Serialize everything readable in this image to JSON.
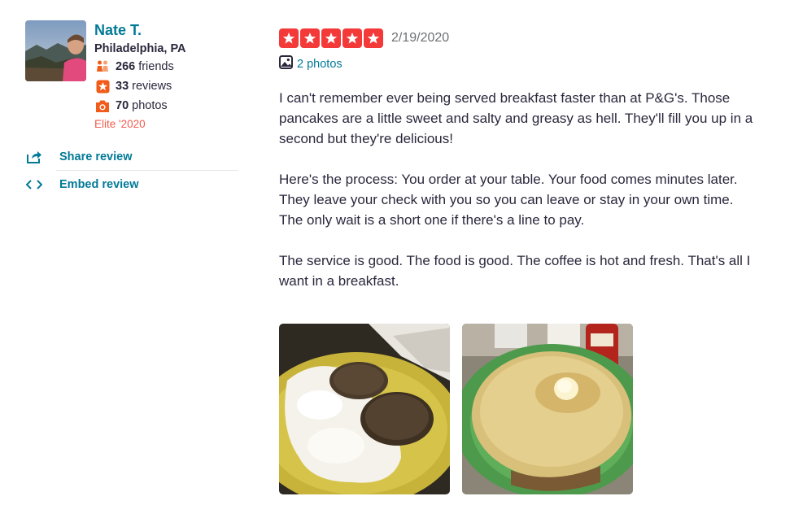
{
  "user": {
    "name": "Nate T.",
    "location": "Philadelphia, PA",
    "friends_count": "266",
    "friends_label": "friends",
    "reviews_count": "33",
    "reviews_label": "reviews",
    "photos_count": "70",
    "photos_label": "photos",
    "elite": "Elite '2020",
    "icons": {
      "friends": "friends-icon",
      "reviews": "star-icon",
      "photos": "camera-icon"
    },
    "accent_color": "#027a97",
    "stat_icon_color": "#f15c1a",
    "elite_color": "#f15c4f"
  },
  "actions": {
    "share_label": "Share review",
    "embed_label": "Embed review",
    "icons": {
      "share": "share-icon",
      "embed": "embed-code-icon"
    }
  },
  "review": {
    "rating": 5,
    "rating_max": 5,
    "star_color": "#f43939",
    "date": "2/19/2020",
    "photos_link": "2 photos",
    "photos_icon": "image-icon",
    "paragraphs": [
      "I can't remember ever being served breakfast faster than at P&G's. Those pancakes are a little sweet and salty and greasy as hell. They'll fill you up in a second but they're delicious!",
      "Here's the process: You order at your table. Your food comes minutes later. They leave your check with you so you can leave or stay in your own time. The only wait is a short one if there's a line to pay.",
      "The service is good. The food is good. The coffee is hot and fresh. That's all I want in a breakfast."
    ],
    "photos": [
      {
        "subject": "eggs-and-sausage-photo"
      },
      {
        "subject": "pancake-photo"
      }
    ]
  }
}
